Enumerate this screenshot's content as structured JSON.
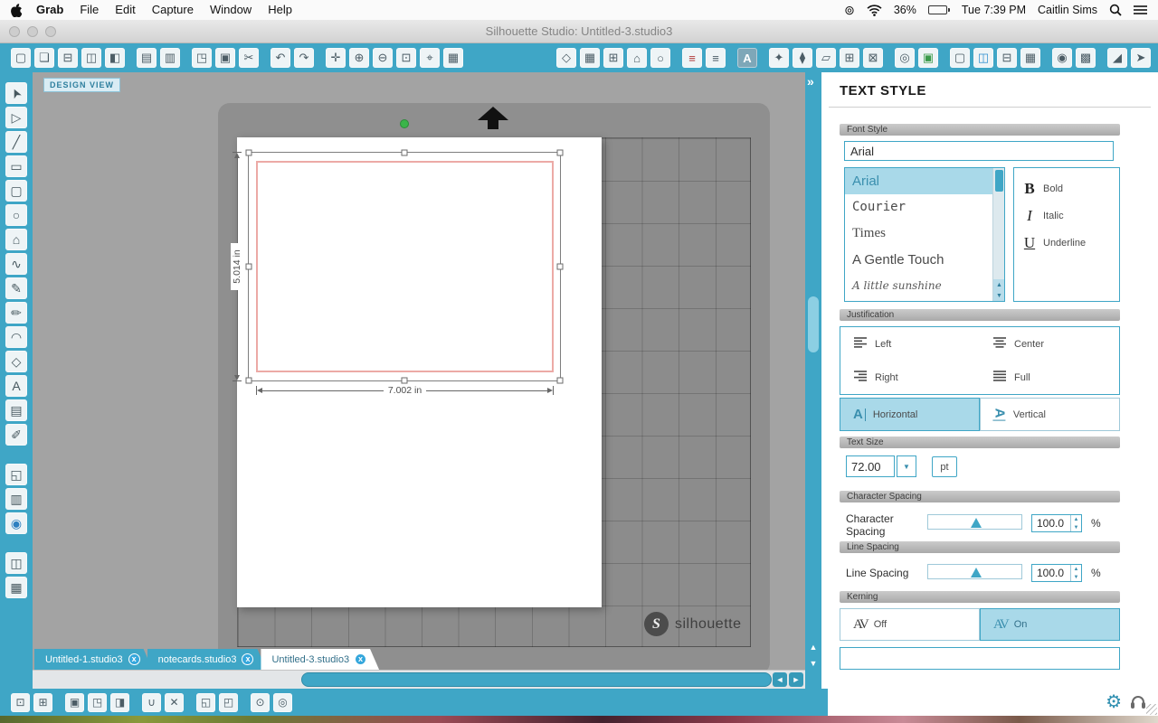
{
  "window": {
    "title": "Silhouette Studio: Untitled-3.studio3"
  },
  "menu_bar": {
    "items": [
      {
        "label": "Grab",
        "active": true
      },
      {
        "label": "File"
      },
      {
        "label": "Edit"
      },
      {
        "label": "Capture"
      },
      {
        "label": "Window"
      },
      {
        "label": "Help"
      }
    ],
    "status": {
      "battery": "36%",
      "clock": "Tue 7:39 PM",
      "user": "Caitlin Sims"
    }
  },
  "toolbar_left": [
    {
      "name": "new-document-icon",
      "glyph": "▢"
    },
    {
      "name": "open-icon",
      "glyph": "❏"
    },
    {
      "name": "import-icon",
      "glyph": "⊟"
    },
    {
      "name": "save-icon",
      "glyph": "◫"
    },
    {
      "name": "save-as-icon",
      "glyph": "◧"
    },
    {
      "name": "print-icon",
      "glyph": "▤",
      "gap": true
    },
    {
      "name": "print-settings-icon",
      "glyph": "▥"
    },
    {
      "name": "copy-icon",
      "glyph": "◳",
      "gap": true
    },
    {
      "name": "paste-icon",
      "glyph": "▣"
    },
    {
      "name": "cut-icon",
      "glyph": "✂"
    },
    {
      "name": "undo-icon",
      "glyph": "↶",
      "gap": true
    },
    {
      "name": "redo-icon",
      "glyph": "↷"
    },
    {
      "name": "pan-icon",
      "glyph": "✛",
      "gap": true
    },
    {
      "name": "zoom-in-icon",
      "glyph": "⊕"
    },
    {
      "name": "zoom-out-icon",
      "glyph": "⊖"
    },
    {
      "name": "zoom-selection-icon",
      "glyph": "⊡"
    },
    {
      "name": "drag-zoom-icon",
      "glyph": "⌖"
    },
    {
      "name": "fit-to-window-icon",
      "glyph": "▦"
    }
  ],
  "toolbar_right": [
    {
      "name": "straw-tool-icon",
      "glyph": "◇"
    },
    {
      "name": "fill-page-icon",
      "glyph": "▦"
    },
    {
      "name": "show-grid-icon",
      "glyph": "⊞"
    },
    {
      "name": "show-store-icon",
      "glyph": "⌂"
    },
    {
      "name": "shapes-icon",
      "glyph": "○"
    },
    {
      "name": "line-style-icon",
      "glyph": "≡",
      "color": "#b03a3a",
      "gap": true
    },
    {
      "name": "fill-style-icon",
      "glyph": "≡"
    },
    {
      "name": "text-style-icon",
      "glyph": "A",
      "selected": true,
      "gap": true
    },
    {
      "name": "replicate-icon",
      "glyph": "✦",
      "gap": true
    },
    {
      "name": "nest-icon",
      "glyph": "⧫"
    },
    {
      "name": "shear-icon",
      "glyph": "▱"
    },
    {
      "name": "object-align-icon",
      "glyph": "⊞"
    },
    {
      "name": "modify-icon",
      "glyph": "⊠"
    },
    {
      "name": "offset-icon",
      "glyph": "◎",
      "gap": true
    },
    {
      "name": "trace-icon",
      "glyph": "▣",
      "color": "#3a9a4a"
    },
    {
      "name": "page-setup-icon",
      "glyph": "▢",
      "gap": true
    },
    {
      "name": "mat-setup-icon",
      "glyph": "◫",
      "color": "#2f8fd0"
    },
    {
      "name": "margins-icon",
      "glyph": "⊟"
    },
    {
      "name": "grid-settings-icon",
      "glyph": "▦"
    },
    {
      "name": "registration-marks-icon",
      "glyph": "◉",
      "gap": true
    },
    {
      "name": "pixscan-icon",
      "glyph": "▩"
    },
    {
      "name": "eraser-icon",
      "glyph": "◢",
      "gap": true
    },
    {
      "name": "send-to-silhouette-icon",
      "glyph": "➤"
    }
  ],
  "left_tools": [
    {
      "name": "select-tool-icon",
      "glyph": "➤",
      "cls": "rot-nw"
    },
    {
      "name": "point-edit-tool-icon",
      "glyph": "▷"
    },
    {
      "name": "line-tool-icon",
      "glyph": "╱"
    },
    {
      "name": "rectangle-tool-icon",
      "glyph": "▭"
    },
    {
      "name": "rounded-rectangle-tool-icon",
      "glyph": "▢"
    },
    {
      "name": "ellipse-tool-icon",
      "glyph": "○"
    },
    {
      "name": "polygon-tool-icon",
      "glyph": "⌂"
    },
    {
      "name": "curve-tool-icon",
      "glyph": "∿"
    },
    {
      "name": "freehand-tool-icon",
      "glyph": "✎"
    },
    {
      "name": "smooth-freehand-tool-icon",
      "glyph": "✏"
    },
    {
      "name": "arc-tool-icon",
      "glyph": "◠"
    },
    {
      "name": "regular-polygon-tool-icon",
      "glyph": "◇"
    },
    {
      "name": "text-tool-icon",
      "glyph": "A"
    },
    {
      "name": "note-tool-icon",
      "glyph": "▤"
    },
    {
      "name": "draw-tool-icon",
      "glyph": "✐"
    },
    {
      "name": "shadow-tool-icon",
      "glyph": "◱",
      "gap": true
    },
    {
      "name": "sketch-tool-icon",
      "glyph": "▥"
    },
    {
      "name": "store-tool-icon",
      "glyph": "◉",
      "color": "#2d7fc0"
    },
    {
      "name": "page-panel-icon",
      "glyph": "◫",
      "gap": true
    },
    {
      "name": "grid-panel-icon",
      "glyph": "▦"
    }
  ],
  "bottom_tools": [
    {
      "name": "transform-icon",
      "glyph": "⊡"
    },
    {
      "name": "scale-icon",
      "glyph": "⊞"
    },
    {
      "name": "copy-object-icon",
      "glyph": "▣",
      "gap": true
    },
    {
      "name": "duplicate-icon",
      "glyph": "◳"
    },
    {
      "name": "mirror-icon",
      "glyph": "◨"
    },
    {
      "name": "weld-icon",
      "glyph": "∪",
      "gap": true
    },
    {
      "name": "delete-icon",
      "glyph": "✕"
    },
    {
      "name": "bring-forward-icon",
      "glyph": "◱",
      "gap": true
    },
    {
      "name": "send-backward-icon",
      "glyph": "◰"
    },
    {
      "name": "lock-icon",
      "glyph": "⊙",
      "gap": true
    },
    {
      "name": "center-icon",
      "glyph": "◎"
    }
  ],
  "canvas": {
    "view_label": "DESIGN VIEW",
    "selection": {
      "width_label": "7.002 in",
      "height_label": "5.014 in"
    },
    "logo_mark": "S",
    "logo_text": "silhouette"
  },
  "tabs": [
    {
      "label": "Untitled-1.studio3",
      "active": false
    },
    {
      "label": "notecards.studio3",
      "active": false
    },
    {
      "label": "Untitled-3.studio3",
      "active": true
    }
  ],
  "panel": {
    "title": "TEXT STYLE",
    "font_style": {
      "header": "Font Style",
      "input_value": "Arial",
      "fonts": [
        {
          "name": "Arial",
          "family": "sans",
          "selected": true
        },
        {
          "name": "Courier",
          "family": "mono"
        },
        {
          "name": "Times",
          "family": "serif"
        },
        {
          "name": "A Gentle Touch",
          "family": "sans"
        },
        {
          "name": "A little sunshine",
          "family": "script"
        }
      ],
      "styles": [
        {
          "name": "bold",
          "glyph": "B",
          "label": "Bold"
        },
        {
          "name": "italic",
          "glyph": "I",
          "label": "Italic"
        },
        {
          "name": "underline",
          "glyph": "U",
          "label": "Underline"
        }
      ]
    },
    "justification": {
      "header": "Justification",
      "options": [
        {
          "label": "Left",
          "type": "left"
        },
        {
          "label": "Center",
          "type": "center"
        },
        {
          "label": "Right",
          "type": "right"
        },
        {
          "label": "Full",
          "type": "full"
        }
      ],
      "orientation": [
        {
          "label": "Horizontal",
          "glyph": "A",
          "selected": true
        },
        {
          "label": "Vertical",
          "glyph": "A",
          "selected": false
        }
      ]
    },
    "text_size": {
      "header": "Text Size",
      "value": "72.00",
      "unit": "pt"
    },
    "character_spacing": {
      "header": "Character Spacing",
      "label": "Character Spacing",
      "value": "100.0",
      "unit": "%"
    },
    "line_spacing": {
      "header": "Line Spacing",
      "label": "Line Spacing",
      "value": "100.0",
      "unit": "%"
    },
    "kerning": {
      "header": "Kerning",
      "glyph": "AV",
      "off_label": "Off",
      "on_label": "On"
    }
  }
}
